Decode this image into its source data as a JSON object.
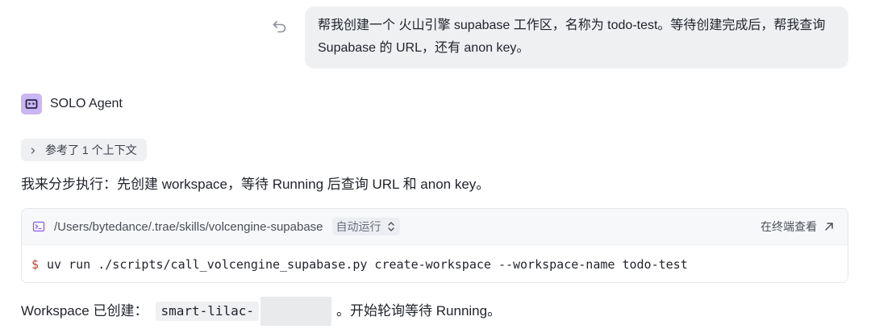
{
  "user_message": {
    "text": "帮我创建一个 火山引擎 supabase 工作区，名称为 todo-test。等待创建完成后，帮我查询 Supabase 的 URL，还有 anon key。"
  },
  "agent": {
    "name": "SOLO Agent",
    "context_chip": "参考了 1 个上下文",
    "plan_text": "我来分步执行：先创建 workspace，等待 Running 后查询 URL 和 anon key。"
  },
  "terminal": {
    "path": "/Users/bytedance/.trae/skills/volcengine-supabase",
    "run_mode": "自动运行",
    "open_in_terminal": "在终端查看",
    "prompt": "$",
    "command": "uv run ./scripts/call_volcengine_supabase.py create-workspace --workspace-name todo-test"
  },
  "status": {
    "prefix": "Workspace 已创建：",
    "workspace_id": "smart-lilac-",
    "suffix": "。开始轮询等待 Running。"
  },
  "colors": {
    "agent_avatar": "#c9b6f2",
    "terminal_icon": "#8b5cf6",
    "prompt": "#d0402b",
    "bubble": "#eff0f2"
  },
  "icons": {
    "undo": "undo-icon",
    "agent": "agent-avatar-icon",
    "chevron": "chevron-right-icon",
    "terminal": "terminal-icon",
    "updown": "chevron-updown-icon",
    "open": "arrow-up-right-icon"
  }
}
